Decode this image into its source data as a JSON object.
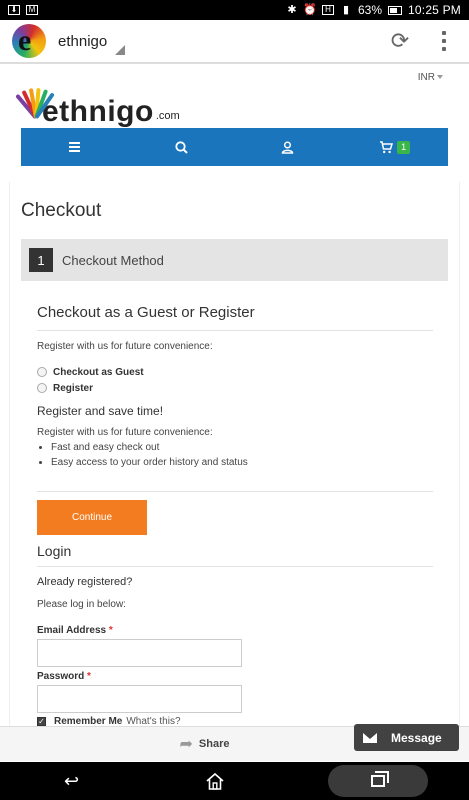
{
  "status_bar": {
    "battery": "63%",
    "time": "10:25 PM",
    "network": "H"
  },
  "app_bar": {
    "title": "ethnigo"
  },
  "site": {
    "logo_text": "ethnigo",
    "logo_suffix": ".com",
    "currency": "INR",
    "cart_count": "1"
  },
  "checkout": {
    "page_title": "Checkout",
    "step_number": "1",
    "step_label": "Checkout Method",
    "guest_section": {
      "title": "Checkout as a Guest or Register",
      "intro": "Register with us for future convenience:",
      "options": [
        "Checkout as Guest",
        "Register"
      ],
      "register_heading": "Register and save time!",
      "register_intro": "Register with us for future convenience:",
      "benefits": [
        "Fast and easy check out",
        "Easy access to your order history and status"
      ],
      "continue_label": "Continue"
    },
    "login_section": {
      "title": "Login",
      "already": "Already registered?",
      "please": "Please log in below:",
      "email_label": "Email Address",
      "password_label": "Password",
      "required_mark": "*",
      "remember_label": "Remember Me",
      "whats_this": "What's this?"
    }
  },
  "share_bar": {
    "share_label": "Share",
    "message_label": "Message"
  }
}
